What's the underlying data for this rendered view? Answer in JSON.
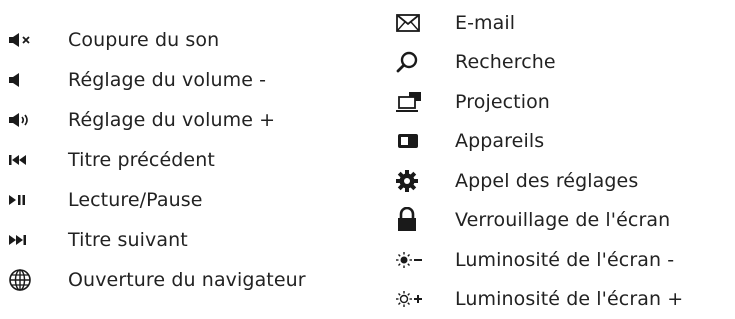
{
  "left_items": [
    {
      "icon": "mute-icon",
      "label": "Coupure du son"
    },
    {
      "icon": "volume-down-icon",
      "label": "Réglage du volume -"
    },
    {
      "icon": "volume-up-icon",
      "label": "Réglage du volume +"
    },
    {
      "icon": "previous-track-icon",
      "label": "Titre précédent"
    },
    {
      "icon": "play-pause-icon",
      "label": "Lecture/Pause"
    },
    {
      "icon": "next-track-icon",
      "label": "Titre suivant"
    },
    {
      "icon": "globe-icon",
      "label": "Ouverture du navigateur"
    }
  ],
  "right_items": [
    {
      "icon": "envelope-icon",
      "label": "E-mail"
    },
    {
      "icon": "search-icon",
      "label": "Recherche"
    },
    {
      "icon": "projection-icon",
      "label": "Projection"
    },
    {
      "icon": "devices-icon",
      "label": "Appareils"
    },
    {
      "icon": "gear-icon",
      "label": "Appel des réglages"
    },
    {
      "icon": "lock-icon",
      "label": "Verrouillage de l'écran"
    },
    {
      "icon": "brightness-down-icon",
      "label": "Luminosité de l'écran -"
    },
    {
      "icon": "brightness-up-icon",
      "label": "Luminosité de l'écran +"
    }
  ],
  "colors": {
    "ink": "#1a1a1a"
  }
}
